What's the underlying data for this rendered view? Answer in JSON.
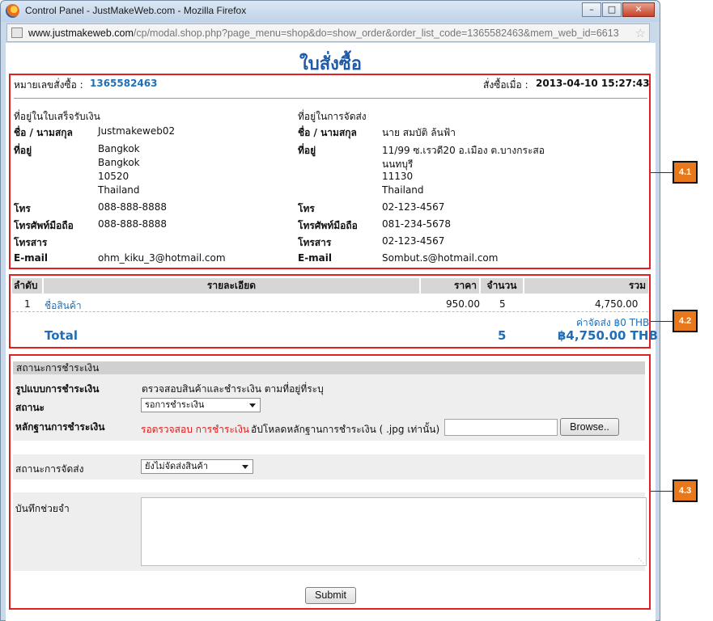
{
  "window": {
    "title": "Control Panel - JustMakeWeb.com - Mozilla Firefox",
    "url_domain": "www.justmakeweb.com",
    "url_path": "/cp/modal.shop.php?page_menu=shop&do=show_order&order_list_code=1365582463&mem_web_id=6613"
  },
  "page": {
    "title": "ใบสั่งซื้อ"
  },
  "order": {
    "number_label": "หมายเลขสั่งซื้อ :",
    "number": "1365582463",
    "date_label": "สั่งซื้อเมื่อ :",
    "date": "2013-04-10 15:27:43"
  },
  "billing": {
    "heading": "ที่อยู่ในใบเสร็จรับเงิน",
    "name_label": "ชื่อ / นามสกุล",
    "name": "Justmakeweb02",
    "address_label": "ที่อยู่",
    "address_lines": [
      "Bangkok",
      "Bangkok",
      "10520",
      "Thailand"
    ],
    "phone_label": "โทร",
    "phone": "088-888-8888",
    "mobile_label": "โทรศัพท์มือถือ",
    "mobile": "088-888-8888",
    "fax_label": "โทรสาร",
    "fax": "",
    "email_label": "E-mail",
    "email": "ohm_kiku_3@hotmail.com"
  },
  "shipping": {
    "heading": "ที่อยู่ในการจัดส่ง",
    "name_label": "ชื่อ / นามสกุล",
    "name": "นาย สมบัติ ล้นฟ้า",
    "address_label": "ที่อยู่",
    "address_lines": [
      "11/99 ซ.เรวดี20 อ.เมือง ต.บางกระสอ",
      "นนทบุรี",
      "11130",
      "Thailand"
    ],
    "phone_label": "โทร",
    "phone": "02-123-4567",
    "mobile_label": "โทรศัพท์มือถือ",
    "mobile": "081-234-5678",
    "fax_label": "โทรสาร",
    "fax": "02-123-4567",
    "email_label": "E-mail",
    "email": "Sombut.s@hotmail.com"
  },
  "items_table": {
    "headers": [
      "ลำดับ",
      "รายละเอียด",
      "ราคา",
      "จำนวน",
      "รวม"
    ],
    "rows": [
      {
        "no": "1",
        "name": "ชื่อสินค้า",
        "price": "950.00",
        "qty": "5",
        "total": "4,750.00"
      }
    ],
    "shipping_fee": "ค่าจัดส่ง ฿0 THB",
    "total_label": "Total",
    "total_qty": "5",
    "grand_total": "฿4,750.00 THB"
  },
  "payment": {
    "section_title": "สถานะการชำระเงิน",
    "method_label": "รูปแบบการชำระเงิน",
    "method": "ตรวจสอบสินค้าและชำระเงิน ตามที่อยู่ที่ระบุ",
    "status_label": "สถานะ",
    "status_value": "รอการชำระเงิน",
    "proof_label": "หลักฐานการชำระเงิน",
    "proof_status": "รอตรวจสอบ การชำระเงิน",
    "upload_hint": "อัปโหลดหลักฐานการชำระเงิน ( .jpg เท่านั้น)",
    "browse_label": "Browse..",
    "shipping_status_label": "สถานะการจัดส่ง",
    "shipping_status_value": "ยังไม่จัดส่งสินค้า",
    "memo_label": "บันทึกช่วยจำ",
    "memo_value": "",
    "submit_label": "Submit"
  },
  "callouts": [
    "4.1",
    "4.2",
    "4.3"
  ],
  "colors": {
    "accent_blue": "#1f6fb8",
    "title_blue": "#1f5aa8",
    "annotation_red": "#e02020",
    "callout_orange": "#e8781a"
  }
}
